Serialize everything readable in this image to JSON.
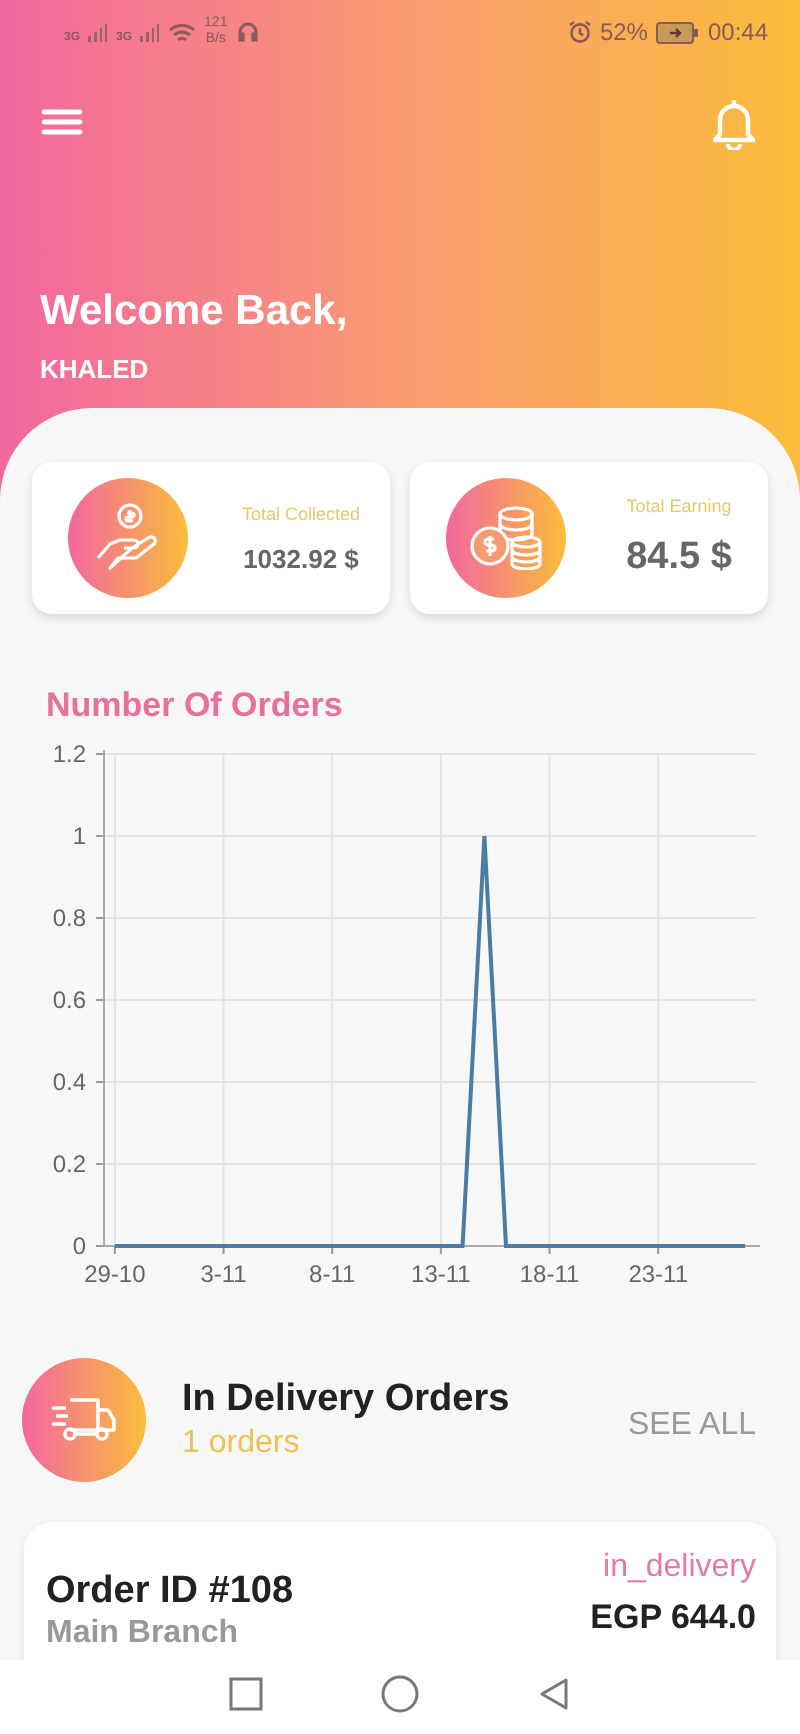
{
  "status_bar": {
    "network_1": "3G",
    "network_2": "3G",
    "speed": "121",
    "speed_unit": "B/s",
    "battery": "52%",
    "time": "00:44"
  },
  "header": {
    "greeting": "Welcome Back,",
    "user_name": "KHALED"
  },
  "stats": [
    {
      "kind": "collected",
      "label": "Total Collected",
      "value": "1032.92 $"
    },
    {
      "kind": "earning",
      "label": "Total Earning",
      "value": "84.5 $"
    }
  ],
  "chart": {
    "title": "Number Of Orders",
    "chart_data": {
      "type": "line",
      "categories": [
        "29-10",
        null,
        null,
        null,
        null,
        "3-11",
        null,
        null,
        null,
        null,
        "8-11",
        null,
        null,
        null,
        null,
        "13-11",
        null,
        null,
        null,
        null,
        "18-11",
        null,
        null,
        null,
        null,
        "23-11",
        null,
        null,
        null,
        null
      ],
      "series": [
        {
          "color": "#4b7ca3",
          "values": [
            0,
            0,
            0,
            0,
            0,
            0,
            0,
            0,
            0,
            0,
            0,
            0,
            0,
            0,
            0,
            0,
            0,
            1,
            0,
            0,
            0,
            0,
            0,
            0,
            0,
            0,
            0,
            0,
            0,
            0
          ]
        }
      ],
      "ylim": [
        0,
        1.2
      ],
      "grid": true,
      "yticks": [
        {
          "value": 0,
          "label": "0"
        },
        {
          "value": 0.2,
          "label": "0.2"
        },
        {
          "value": 0.4,
          "label": "0.4"
        },
        {
          "value": 0.6,
          "label": "0.6"
        },
        {
          "value": 0.8,
          "label": "0.8"
        },
        {
          "value": 1,
          "label": "1"
        },
        {
          "value": 1.2,
          "label": "1.2"
        }
      ]
    }
  },
  "delivery": {
    "title": "In Delivery Orders",
    "count": "1 orders",
    "see_all": "SEE ALL"
  },
  "orders": [
    {
      "order_id": "Order ID #108",
      "branch": "Main Branch",
      "status": "in_delivery",
      "total": "EGP 644.0"
    }
  ]
}
